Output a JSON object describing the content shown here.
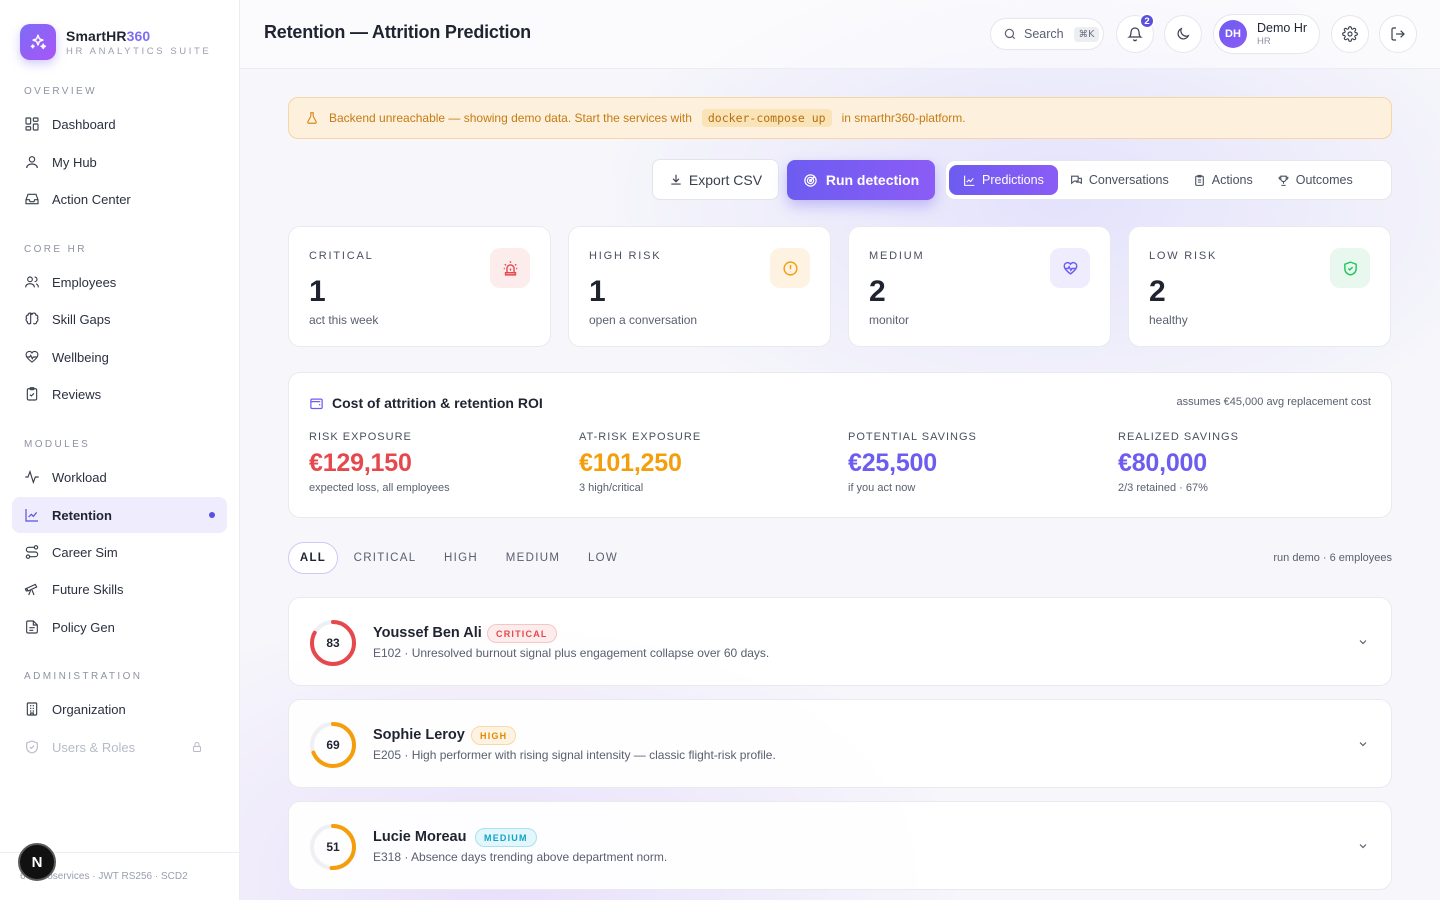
{
  "brand": {
    "name_main": "SmartHR",
    "name_accent": "360",
    "subtitle": "HR ANALYTICS SUITE"
  },
  "sidebar": {
    "sections": [
      {
        "label": "OVERVIEW",
        "items": [
          {
            "label": "Dashboard",
            "icon": "dashboard-icon"
          },
          {
            "label": "My Hub",
            "icon": "user-icon"
          },
          {
            "label": "Action Center",
            "icon": "inbox-icon"
          }
        ]
      },
      {
        "label": "CORE HR",
        "items": [
          {
            "label": "Employees",
            "icon": "users-icon"
          },
          {
            "label": "Skill Gaps",
            "icon": "brain-icon"
          },
          {
            "label": "Wellbeing",
            "icon": "heart-pulse-icon"
          },
          {
            "label": "Reviews",
            "icon": "clipboard-check-icon"
          }
        ]
      },
      {
        "label": "MODULES",
        "items": [
          {
            "label": "Workload",
            "icon": "activity-icon"
          },
          {
            "label": "Retention",
            "icon": "line-chart-icon",
            "active": true
          },
          {
            "label": "Career Sim",
            "icon": "route-icon"
          },
          {
            "label": "Future Skills",
            "icon": "telescope-icon"
          },
          {
            "label": "Policy Gen",
            "icon": "file-text-icon"
          }
        ]
      },
      {
        "label": "ADMINISTRATION",
        "items": [
          {
            "label": "Organization",
            "icon": "building-icon"
          },
          {
            "label": "Users & Roles",
            "icon": "shield-icon",
            "disabled": true
          }
        ]
      }
    ],
    "footer_text": "6 microservices · JWT RS256 · SCD2",
    "footer_badge": "N"
  },
  "header": {
    "title": "Retention — Attrition Prediction",
    "search_label": "Search",
    "search_shortcut": "⌘K",
    "notification_count": "2",
    "user": {
      "initials": "DH",
      "name": "Demo Hr",
      "role": "HR"
    }
  },
  "banner": {
    "text_before": "Backend unreachable — showing demo data. Start the services with",
    "command": "docker-compose up",
    "text_after": "in smarthr360-platform."
  },
  "actions": {
    "export_label": "Export CSV",
    "run_label": "Run detection"
  },
  "tabs": [
    {
      "label": "Predictions",
      "icon": "chart-icon",
      "active": true
    },
    {
      "label": "Conversations",
      "icon": "chat-icon"
    },
    {
      "label": "Actions",
      "icon": "clipboard-icon"
    },
    {
      "label": "Outcomes",
      "icon": "trophy-icon"
    }
  ],
  "kpis": [
    {
      "label": "CRITICAL",
      "value": "1",
      "sub": "act this week",
      "icon": "siren-icon",
      "color": "#e5484d",
      "bg": "#fdecec"
    },
    {
      "label": "HIGH RISK",
      "value": "1",
      "sub": "open a conversation",
      "icon": "alert-circle-icon",
      "color": "#f59e0b",
      "bg": "#fef3e2"
    },
    {
      "label": "MEDIUM",
      "value": "2",
      "sub": "monitor",
      "icon": "heart-pulse-icon",
      "color": "#6d5cf0",
      "bg": "#efedfd"
    },
    {
      "label": "LOW RISK",
      "value": "2",
      "sub": "healthy",
      "icon": "shield-check-icon",
      "color": "#22c55e",
      "bg": "#e8f8ee"
    }
  ],
  "roi": {
    "title": "Cost of attrition & retention ROI",
    "note": "assumes €45,000 avg replacement cost",
    "metrics": [
      {
        "label": "RISK EXPOSURE",
        "value": "€129,150",
        "sub": "expected loss, all employees",
        "color": "#e5484d"
      },
      {
        "label": "AT-RISK EXPOSURE",
        "value": "€101,250",
        "sub": "3 high/critical",
        "color": "#f59e0b"
      },
      {
        "label": "POTENTIAL SAVINGS",
        "value": "€25,500",
        "sub": "if you act now",
        "color": "#6d5cf0"
      },
      {
        "label": "REALIZED SAVINGS",
        "value": "€80,000",
        "sub": "2/3 retained · 67%",
        "color": "#6d5cf0"
      }
    ]
  },
  "filters": {
    "options": [
      "ALL",
      "CRITICAL",
      "HIGH",
      "MEDIUM",
      "LOW"
    ],
    "selected": "ALL",
    "run_meta": "run demo · 6 employees"
  },
  "employees": [
    {
      "score": 83,
      "score_fraction": 0.83,
      "name": "Youssef Ben Ali",
      "level": "CRITICAL",
      "ring_color": "#e5484d",
      "badge_color": "#e5484d",
      "badge_bg": "#fdecec",
      "badge_border": "#f6c6c7",
      "description": "E102 · Unresolved burnout signal plus engagement collapse over 60 days."
    },
    {
      "score": 69,
      "score_fraction": 0.69,
      "name": "Sophie Leroy",
      "level": "HIGH",
      "ring_color": "#f59e0b",
      "badge_color": "#e08a00",
      "badge_bg": "#fef3e2",
      "badge_border": "#f8d9a5",
      "description": "E205 · High performer with rising signal intensity — classic flight-risk profile."
    },
    {
      "score": 51,
      "score_fraction": 0.51,
      "name": "Lucie Moreau",
      "level": "MEDIUM",
      "ring_color": "#f59e0b",
      "badge_color": "#0ea5c6",
      "badge_bg": "#e2f6fb",
      "badge_border": "#a9e1ee",
      "description": "E318 · Absence days trending above department norm."
    }
  ]
}
